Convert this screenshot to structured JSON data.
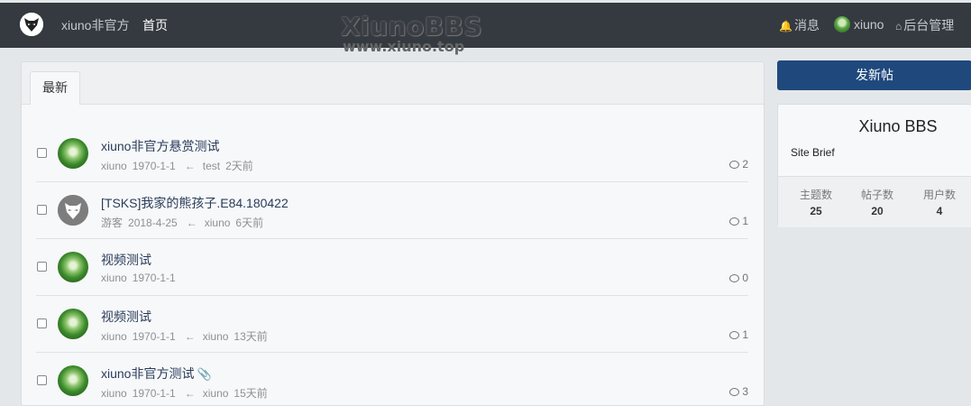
{
  "nav": {
    "brand": "xiuno非官方",
    "home": "首页",
    "messages": "消息",
    "user": "xiuno",
    "admin": "后台管理"
  },
  "watermark": {
    "line1": "XiunoBBS",
    "line2": "www.xiuno.top"
  },
  "tabs": [
    {
      "label": "最新"
    }
  ],
  "threads": [
    {
      "title": "xiuno非官方悬赏测试",
      "author": "xiuno",
      "date": "1970-1-1",
      "last_user": "test",
      "last_time": "2天前",
      "replies": "2",
      "avatar": "green"
    },
    {
      "title": "[TSKS]我家的熊孩子.E84.180422",
      "author": "游客",
      "date": "2018-4-25",
      "last_user": "xiuno",
      "last_time": "6天前",
      "replies": "1",
      "avatar": "gray"
    },
    {
      "title": "视频测试",
      "author": "xiuno",
      "date": "1970-1-1",
      "last_user": "",
      "last_time": "",
      "replies": "0",
      "avatar": "green"
    },
    {
      "title": "视频测试",
      "author": "xiuno",
      "date": "1970-1-1",
      "last_user": "xiuno",
      "last_time": "13天前",
      "replies": "1",
      "avatar": "green"
    },
    {
      "title": "xiuno非官方测试",
      "author": "xiuno",
      "date": "1970-1-1",
      "last_user": "xiuno",
      "last_time": "15天前",
      "replies": "3",
      "avatar": "green",
      "attachment": true
    }
  ],
  "arrow": "←",
  "sidebar": {
    "new_thread_button": "发新帖",
    "site_name": "Xiuno BBS",
    "site_brief": "Site Brief",
    "stats": [
      {
        "label": "主题数",
        "value": "25"
      },
      {
        "label": "帖子数",
        "value": "20"
      },
      {
        "label": "用户数",
        "value": "4"
      }
    ]
  },
  "colors": {
    "topbar": "#343a40",
    "accent": "#1f497d",
    "background": "#e4e7ea"
  }
}
